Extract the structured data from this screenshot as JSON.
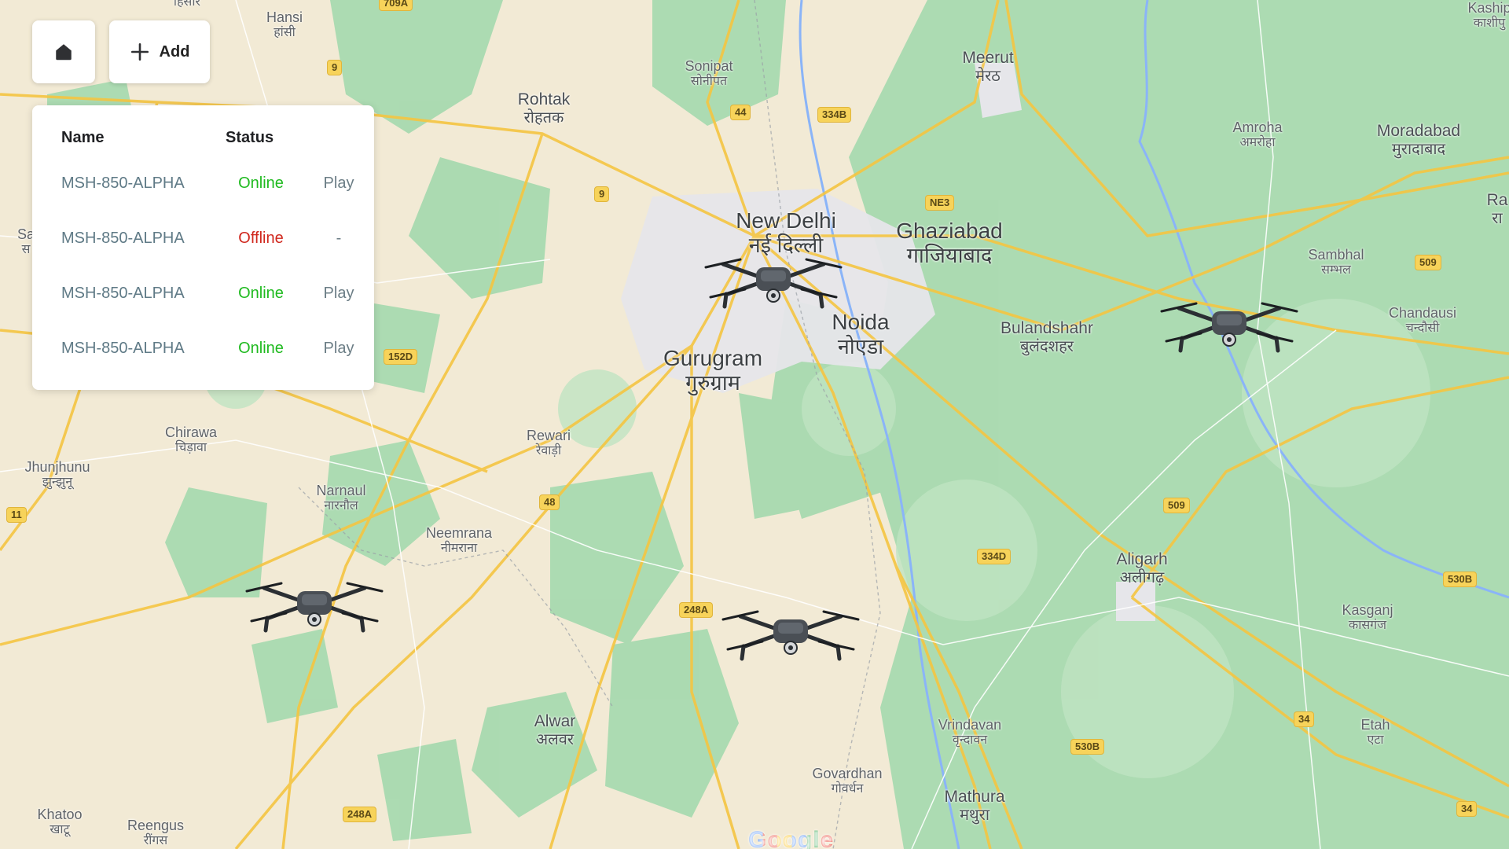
{
  "toolbar": {
    "home_icon": "home-icon",
    "add_icon": "plus-icon",
    "add_label": "Add"
  },
  "drone_table": {
    "headers": {
      "name": "Name",
      "status": "Status"
    },
    "rows": [
      {
        "name": "MSH-850-ALPHA",
        "status": "Online",
        "status_color": "#1fba1f",
        "action": "Play"
      },
      {
        "name": "MSH-850-ALPHA",
        "status": "Offline",
        "status_color": "#d0271d",
        "action": "-"
      },
      {
        "name": "MSH-850-ALPHA",
        "status": "Online",
        "status_color": "#1fba1f",
        "action": "Play"
      },
      {
        "name": "MSH-850-ALPHA",
        "status": "Online",
        "status_color": "#1fba1f",
        "action": "Play"
      }
    ]
  },
  "map": {
    "attribution": "Google",
    "places": {
      "hisar": {
        "hi": "हिसार"
      },
      "hansi": {
        "en": "Hansi",
        "hi": "हांसी"
      },
      "sonipat": {
        "en": "Sonipat",
        "hi": "सोनीपत"
      },
      "meerut": {
        "en": "Meerut",
        "hi": "मेरठ"
      },
      "kashipur": {
        "en": "Kaship",
        "hi": "काशीपु"
      },
      "rohtak": {
        "en": "Rohtak",
        "hi": "रोहतक"
      },
      "amroha": {
        "en": "Amroha",
        "hi": "अमरोहा"
      },
      "moradabad": {
        "en": "Moradabad",
        "hi": "मुरादाबाद"
      },
      "ra": {
        "en": "Ra",
        "hi": "रा"
      },
      "new_delhi": {
        "en": "New Delhi",
        "hi": "नई दिल्ली"
      },
      "ghaziabad": {
        "en": "Ghaziabad",
        "hi": "गाजियाबाद"
      },
      "sambhal": {
        "en": "Sambhal",
        "hi": "सम्भल"
      },
      "chandausi": {
        "en": "Chandausi",
        "hi": "चन्दौसी"
      },
      "noida": {
        "en": "Noida",
        "hi": "नोएडा"
      },
      "gurugram": {
        "en": "Gurugram",
        "hi": "गुरुग्राम"
      },
      "bulandshahr": {
        "en": "Bulandshahr",
        "hi": "बुलंदशहर"
      },
      "chirawa": {
        "en": "Chirawa",
        "hi": "चिड़ावा"
      },
      "rewari": {
        "en": "Rewari",
        "hi": "रेवाड़ी"
      },
      "jhunjhunu": {
        "en": "Jhunjhunu",
        "hi": "झुन्झुनू"
      },
      "narnaul": {
        "en": "Narnaul",
        "hi": "नारनौल"
      },
      "neemrana": {
        "en": "Neemrana",
        "hi": "नीमराना"
      },
      "aligarh": {
        "en": "Aligarh",
        "hi": "अलीगढ़"
      },
      "kasganj": {
        "en": "Kasganj",
        "hi": "कासगंज"
      },
      "alwar": {
        "en": "Alwar",
        "hi": "अलवर"
      },
      "vrindavan": {
        "en": "Vrindavan",
        "hi": "वृन्दावन"
      },
      "etah": {
        "en": "Etah",
        "hi": "एटा"
      },
      "govardhan": {
        "en": "Govardhan",
        "hi": "गोवर्धन"
      },
      "mathura": {
        "en": "Mathura",
        "hi": "मथुरा"
      },
      "khatoo": {
        "en": "Khatoo",
        "hi": "खाटू"
      },
      "reengus": {
        "en": "Reengus",
        "hi": "रींगस"
      },
      "sa": {
        "en": "Sa",
        "hi": "स"
      }
    },
    "road_shields": [
      "709A",
      "9",
      "44",
      "334B",
      "9",
      "NE3",
      "509",
      "152D",
      "11",
      "48",
      "509",
      "334D",
      "248A",
      "530B",
      "34",
      "530B",
      "34",
      "248A"
    ],
    "drones": [
      "drone-icon",
      "drone-icon",
      "drone-icon",
      "drone-icon"
    ]
  }
}
